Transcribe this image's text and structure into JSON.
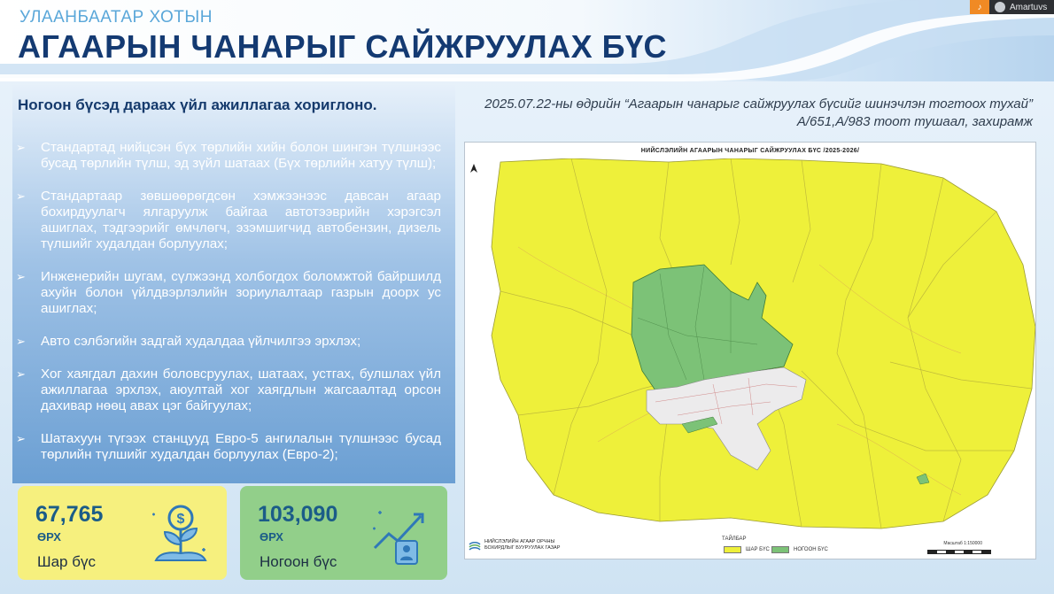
{
  "header": {
    "city": "УЛААНБААТАР ХОТЫН",
    "title": "АГААРЫН ЧАНАРЫГ САЙЖРУУЛАХ БҮС"
  },
  "topbar": {
    "user_name": "Amartuvs"
  },
  "left": {
    "intro": "Ногоон бүсэд дараах үйл ажиллагаа хориглоно.",
    "rules": [
      "Стандартад нийцсэн бүх төрлийн хийн болон шингэн түлшнээс бусад төрлийн түлш, эд зүйл шатаах (Бүх төрлийн хатуу түлш);",
      "Стандартаар зөвшөөрөгдсөн хэмжээнээс давсан агаар бохирдуулагч ялгаруулж байгаа автотээврийн хэрэгсэл ашиглах, тэдгээрийг өмчлөгч, эзэмшигчид автобензин, дизель түлшийг худалдан борлуулах;",
      "Инженерийн шугам, сүлжээнд холбогдох боломжтой байршилд ахуйн болон үйлдвэрлэлийн зориулалтаар газрын доорх ус ашиглах;",
      "Авто сэлбэгийн задгай худалдаа үйлчилгээ эрхлэх;",
      "Хог хаягдал дахин боловсруулах, шатаах, устгах, булшлах үйл ажиллагаа эрхлэх, аюултай хог хаягдлын жагсаалтад орсон дахивар нөөц авах цэг байгуулах;",
      "Шатахуун түгээх станцууд Евро-5 ангилалын түлшнээс бусад төрлийн түлшийг худалдан борлуулах (Евро-2);"
    ]
  },
  "cards": [
    {
      "value": "67,765",
      "unit": "ӨРХ",
      "label": "Шар бүс",
      "icon": "money-plant-icon",
      "color": "#f6f07e"
    },
    {
      "value": "103,090",
      "unit": "ӨРХ",
      "label": "Ногоон бүс",
      "icon": "growth-chart-icon",
      "color": "#92cf8a"
    }
  ],
  "caption": "2025.07.22-ны өдрийн “Агаарын чанарыг сайжруулах бүсийг шинэчлэн тогтоох тухай” А/651,А/983 тоот тушаал, захирамж",
  "map": {
    "title": "НИЙСЛЭЛИЙН АГААРЫН ЧАНАРЫГ САЙЖРУУЛАХ БҮС /2025-2026/",
    "legend_title": "ТАЙЛБАР",
    "legend": [
      {
        "label": "ШАР БҮС",
        "color": "#eef03a"
      },
      {
        "label": "НОГООН БҮС",
        "color": "#7cc277"
      }
    ],
    "agency_line1": "НИЙСЛЭЛИЙН АГААР ОРЧНЫ",
    "agency_line2": "БОХИРДЛЫГ БУУРУУЛАХ ГАЗАР",
    "scale": "Масштаб 1:150000"
  }
}
